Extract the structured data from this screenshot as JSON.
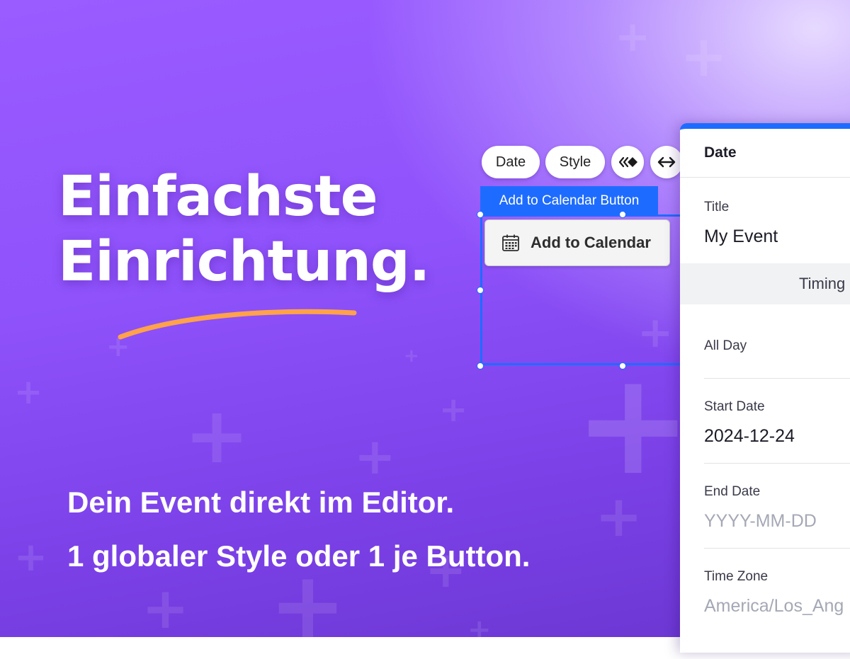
{
  "hero": {
    "headline_line1": "Einfachste",
    "headline_line2": "Einrichtung.",
    "subline_1": "Dein Event direkt im Editor.",
    "subline_2": "1 globaler Style oder 1 je Button."
  },
  "toolbar": {
    "date_label": "Date",
    "style_label": "Style",
    "animation_icon": "animation-icon",
    "stretch_icon": "stretch-icon"
  },
  "selection": {
    "tag_label": "Add to Calendar Button"
  },
  "widget": {
    "button_label": "Add to Calendar",
    "button_icon": "calendar-icon"
  },
  "panel": {
    "header": "Date",
    "title_label": "Title",
    "title_value": "My Event",
    "timing_label": "Timing",
    "allday_label": "All Day",
    "startdate_label": "Start Date",
    "startdate_value": "2024-12-24",
    "enddate_label": "End Date",
    "enddate_placeholder": "YYYY-MM-DD",
    "timezone_label": "Time Zone",
    "timezone_placeholder": "America/Los_Ang"
  },
  "colors": {
    "accent": "#1e6cff",
    "underline": "#ffa24a",
    "background": "#9a5cff"
  }
}
